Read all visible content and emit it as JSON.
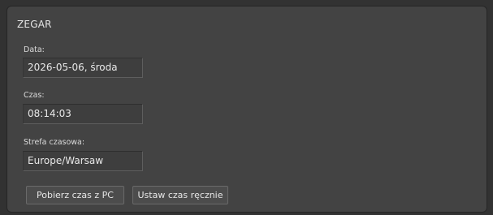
{
  "panel": {
    "title": "ZEGAR"
  },
  "date": {
    "label": "Data:",
    "value": "2026-05-06, środa"
  },
  "time": {
    "label": "Czas:",
    "value": "08:14:03"
  },
  "timezone": {
    "label": "Strefa czasowa:",
    "value": "Europe/Warsaw"
  },
  "buttons": {
    "fetch_pc_time": "Pobierz czas z PC",
    "set_manually": "Ustaw czas ręcznie"
  }
}
